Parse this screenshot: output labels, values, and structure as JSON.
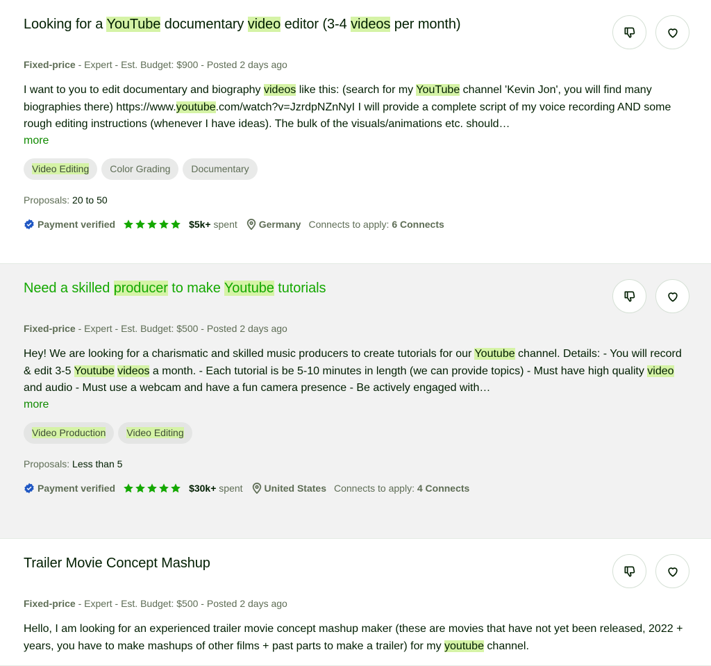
{
  "jobs": [
    {
      "title_segments": [
        {
          "text": "Looking for a ",
          "hl": false
        },
        {
          "text": "YouTube",
          "hl": true
        },
        {
          "text": " documentary ",
          "hl": false
        },
        {
          "text": "video",
          "hl": true
        },
        {
          "text": " editor (3-4 ",
          "hl": false
        },
        {
          "text": "videos",
          "hl": true
        },
        {
          "text": " per month)",
          "hl": false
        }
      ],
      "job_type": "Fixed-price",
      "level": "Expert",
      "budget_label": "Est. Budget:",
      "budget": "$900",
      "posted": "Posted 2 days ago",
      "description_segments": [
        {
          "text": "I want to you to edit documentary and biography ",
          "hl": false
        },
        {
          "text": "videos",
          "hl": true
        },
        {
          "text": " like this: (search for my ",
          "hl": false
        },
        {
          "text": "YouTube",
          "hl": true
        },
        {
          "text": " channel 'Kevin Jon', you will find many biographies there) https://www.",
          "hl": false
        },
        {
          "text": "youtube",
          "hl": true
        },
        {
          "text": ".com/watch?v=JzrdpNZnNyI I will provide a complete script of my voice recording AND some rough editing instructions (whenever I have ideas). The bulk of the visuals/animations etc. should…",
          "hl": false
        }
      ],
      "more_label": "more",
      "tags": [
        {
          "text": "Video Editing",
          "hl": true
        },
        {
          "text": "Color Grading",
          "hl": false
        },
        {
          "text": "Documentary",
          "hl": false
        }
      ],
      "proposals_label": "Proposals:",
      "proposals": "20 to 50",
      "payment_verified": "Payment verified",
      "rating_stars": 5,
      "spent_amount": "$5k+",
      "spent_label": "spent",
      "location": "Germany",
      "connects_label": "Connects to apply:",
      "connects": "6 Connects",
      "hovered": false
    },
    {
      "title_segments": [
        {
          "text": "Need a skilled ",
          "hl": false
        },
        {
          "text": "producer",
          "hl": true
        },
        {
          "text": " to make ",
          "hl": false
        },
        {
          "text": "Youtube",
          "hl": true
        },
        {
          "text": " tutorials",
          "hl": false
        }
      ],
      "job_type": "Fixed-price",
      "level": "Expert",
      "budget_label": "Est. Budget:",
      "budget": "$500",
      "posted": "Posted 2 days ago",
      "description_segments": [
        {
          "text": "Hey! We are looking for a charismatic and skilled music producers to create tutorials for our ",
          "hl": false
        },
        {
          "text": "Youtube",
          "hl": true
        },
        {
          "text": " channel. Details: - You will record & edit 3-5 ",
          "hl": false
        },
        {
          "text": "Youtube",
          "hl": true
        },
        {
          "text": " ",
          "hl": false
        },
        {
          "text": "videos",
          "hl": true
        },
        {
          "text": " a month. - Each tutorial is be 5-10 minutes in length (we can provide topics) - Must have high quality ",
          "hl": false
        },
        {
          "text": "video",
          "hl": true
        },
        {
          "text": " and audio - Must use a webcam and have a fun camera presence - Be actively engaged with…",
          "hl": false
        }
      ],
      "more_label": "more",
      "tags": [
        {
          "text": "Video Production",
          "hl": true
        },
        {
          "text": "Video Editing",
          "hl": true
        }
      ],
      "proposals_label": "Proposals:",
      "proposals": "Less than 5",
      "payment_verified": "Payment verified",
      "rating_stars": 5,
      "spent_amount": "$30k+",
      "spent_label": "spent",
      "location": "United States",
      "connects_label": "Connects to apply:",
      "connects": "4 Connects",
      "hovered": true
    },
    {
      "title_segments": [
        {
          "text": "Trailer Movie Concept Mashup",
          "hl": false
        }
      ],
      "job_type": "Fixed-price",
      "level": "Expert",
      "budget_label": "Est. Budget:",
      "budget": "$500",
      "posted": "Posted 2 days ago",
      "description_segments": [
        {
          "text": "Hello, I am looking for an experienced trailer movie concept mashup maker (these are movies that have not yet been released, 2022 + years, you have to make mashups of other films + past parts to make a trailer) for my ",
          "hl": false
        },
        {
          "text": "youtube",
          "hl": true
        },
        {
          "text": " channel.",
          "hl": false
        }
      ],
      "hovered": false
    }
  ],
  "icons": {
    "dislike": "thumbs-down-icon",
    "save": "heart-icon",
    "verified": "verified-badge-icon",
    "star": "star-icon",
    "location": "map-pin-icon"
  },
  "colors": {
    "highlight": "#d5f3a6",
    "accent_green": "#14a800",
    "link_green": "#108a00",
    "star_green": "#14a800",
    "verified_blue": "#1f57c3",
    "hover_bg": "#f2f2f2"
  }
}
